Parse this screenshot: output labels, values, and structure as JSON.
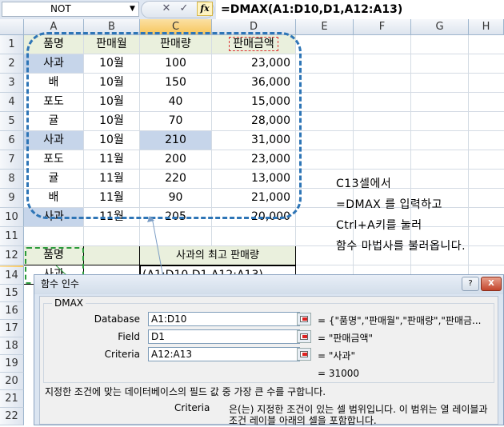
{
  "formula_bar": {
    "name_box": "NOT",
    "cancel_glyph": "✕",
    "enter_glyph": "✓",
    "fx_label": "fx",
    "formula": "=DMAX(A1:D10,D1,A12:A13)"
  },
  "columns": [
    "A",
    "B",
    "C",
    "D",
    "E",
    "F",
    "G",
    "H"
  ],
  "rows": [
    "1",
    "2",
    "3",
    "4",
    "5",
    "6",
    "7",
    "8",
    "9",
    "10",
    "11",
    "12",
    "13",
    "14",
    "15",
    "16",
    "17",
    "18",
    "19",
    "20",
    "21",
    "22"
  ],
  "table": {
    "headers": [
      "품명",
      "판매월",
      "판매량",
      "판매금액"
    ],
    "data": [
      [
        "사과",
        "10월",
        "100",
        "23,000"
      ],
      [
        "배",
        "10월",
        "150",
        "36,000"
      ],
      [
        "포도",
        "10월",
        "40",
        "15,000"
      ],
      [
        "귤",
        "10월",
        "70",
        "28,000"
      ],
      [
        "사과",
        "10월",
        "210",
        "31,000"
      ],
      [
        "포도",
        "11월",
        "200",
        "23,000"
      ],
      [
        "귤",
        "11월",
        "220",
        "13,000"
      ],
      [
        "배",
        "11월",
        "90",
        "21,000"
      ],
      [
        "사과",
        "11월",
        "205",
        "20,000"
      ]
    ]
  },
  "criteria": {
    "header": "품명",
    "value": "사과",
    "result_label": "사과의 최고 판매량",
    "edit_text": "(A1:D10,D1,A12:A13)"
  },
  "annotation": [
    "C13셀에서",
    "=DMAX 를 입력하고",
    "Ctrl+A키를 눌러",
    "함수 마법사를 불러옵니다."
  ],
  "dialog": {
    "title": "함수 인수",
    "help_glyph": "?",
    "close_glyph": "X",
    "function_name": "DMAX",
    "args": [
      {
        "label": "Database",
        "value": "A1:D10",
        "preview": "= {\"품명\",\"판매월\",\"판매량\",\"판매금..."
      },
      {
        "label": "Field",
        "value": "D1",
        "preview": "= \"판매금액\""
      },
      {
        "label": "Criteria",
        "value": "A12:A13",
        "preview": "= \"사과\""
      }
    ],
    "result": "=  31000",
    "description": "지정한 조건에 맞는 데이터베이스의 필드 값 중 가장 큰 수를 구합니다.",
    "arg_help_name": "Criteria",
    "arg_help_line1": "은(는) 지정한 조건이 있는 셀 범위입니다. 이 범위는 열 레이블과",
    "arg_help_line2": "조건 레이블 아래의 셀을 포함합니다."
  },
  "colors": {
    "dashed_border": "#2e75b6",
    "selection_green": "#2a9b3a",
    "highlight": "#c6d5ea"
  }
}
